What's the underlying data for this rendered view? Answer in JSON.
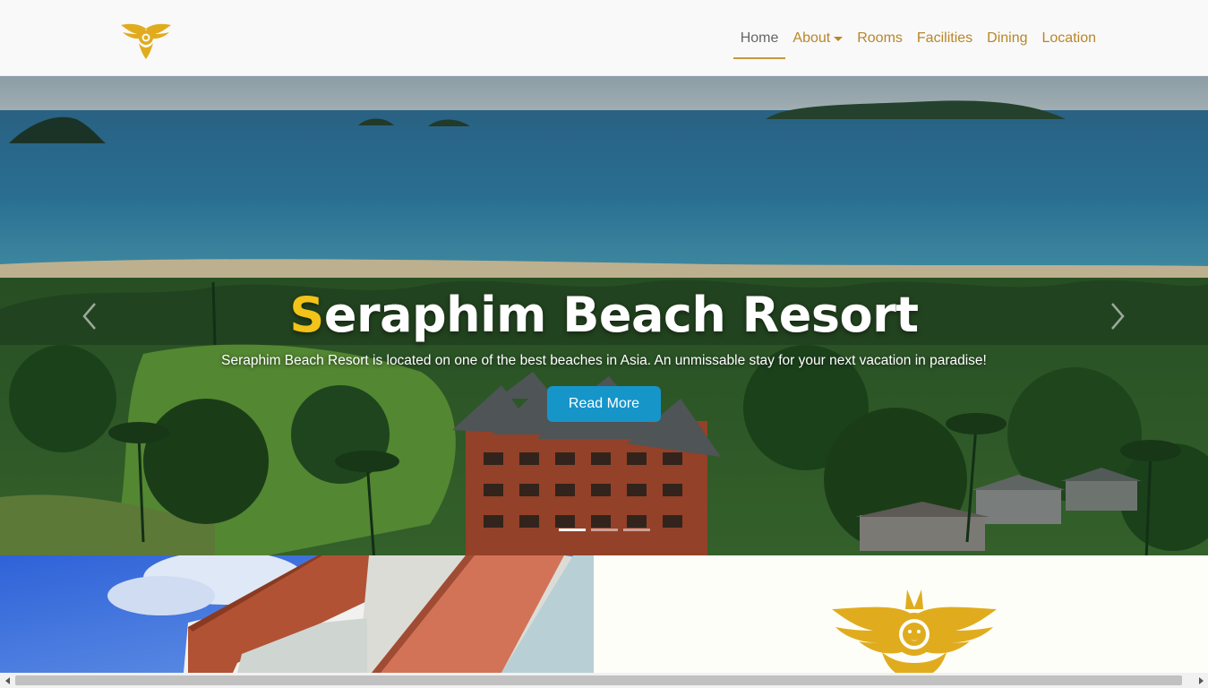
{
  "nav": {
    "items": [
      {
        "label": "Home",
        "active": true
      },
      {
        "label": "About",
        "dropdown": true
      },
      {
        "label": "Rooms"
      },
      {
        "label": "Facilities"
      },
      {
        "label": "Dining"
      },
      {
        "label": "Location"
      }
    ]
  },
  "hero": {
    "title_first_letter": "S",
    "title_rest": "eraphim Beach Resort",
    "subtitle": "Seraphim Beach Resort is located on one of the best beaches in Asia. An unmissable stay for your next vacation in paradise!",
    "button_label": "Read More",
    "slides": 3,
    "active_slide": 1
  },
  "colors": {
    "brand_gold": "#e0ac1e",
    "nav_link": "#b8862a",
    "title_accent": "#f2c318",
    "button": "#1695c9"
  }
}
